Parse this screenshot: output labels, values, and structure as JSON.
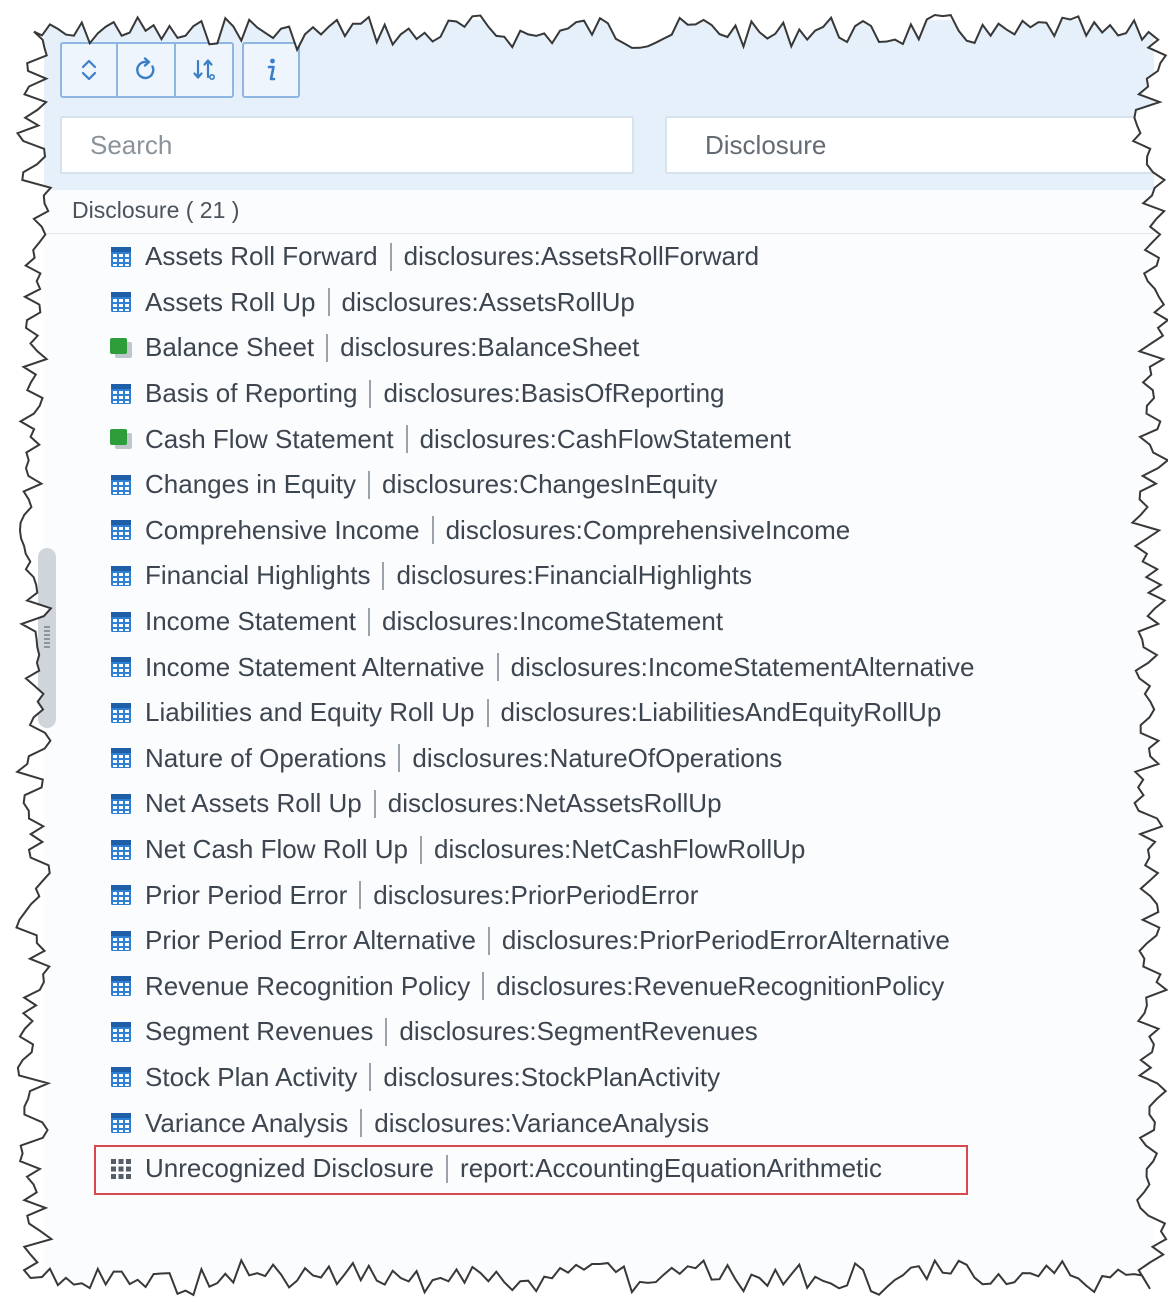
{
  "toolbar": {
    "buttons": [
      {
        "icon": "expand-collapse-icon",
        "label": "⌃⌄"
      },
      {
        "icon": "refresh-icon",
        "label": "↻"
      },
      {
        "icon": "sort-icon",
        "label": "↓↑"
      },
      {
        "icon": "info-icon",
        "label": "i"
      }
    ]
  },
  "search": {
    "placeholder": "Search"
  },
  "filter": {
    "value": "Disclosure"
  },
  "group": {
    "header": "Disclosure ( 21 )"
  },
  "colors": {
    "table_icon": "#2f7fd3",
    "statement_icon": "#2e9e3a",
    "unrecognized_icon": "#555d66",
    "highlight": "#d9474f",
    "accent": "#3a7fc8"
  },
  "items": [
    {
      "name": "Assets Roll Forward",
      "id": "disclosures:AssetsRollForward",
      "icon": "table-icon"
    },
    {
      "name": "Assets Roll Up",
      "id": "disclosures:AssetsRollUp",
      "icon": "table-icon"
    },
    {
      "name": "Balance Sheet",
      "id": "disclosures:BalanceSheet",
      "icon": "statement-icon"
    },
    {
      "name": "Basis of Reporting",
      "id": "disclosures:BasisOfReporting",
      "icon": "table-icon"
    },
    {
      "name": "Cash Flow Statement",
      "id": "disclosures:CashFlowStatement",
      "icon": "statement-icon"
    },
    {
      "name": "Changes in Equity",
      "id": "disclosures:ChangesInEquity",
      "icon": "table-icon"
    },
    {
      "name": "Comprehensive Income",
      "id": "disclosures:ComprehensiveIncome",
      "icon": "table-icon"
    },
    {
      "name": "Financial Highlights",
      "id": "disclosures:FinancialHighlights",
      "icon": "table-icon"
    },
    {
      "name": "Income Statement",
      "id": "disclosures:IncomeStatement",
      "icon": "table-icon"
    },
    {
      "name": "Income Statement Alternative",
      "id": "disclosures:IncomeStatementAlternative",
      "icon": "table-icon"
    },
    {
      "name": "Liabilities and Equity Roll Up",
      "id": "disclosures:LiabilitiesAndEquityRollUp",
      "icon": "table-icon"
    },
    {
      "name": "Nature of Operations",
      "id": "disclosures:NatureOfOperations",
      "icon": "table-icon"
    },
    {
      "name": "Net Assets Roll Up",
      "id": "disclosures:NetAssetsRollUp",
      "icon": "table-icon"
    },
    {
      "name": "Net Cash Flow Roll Up",
      "id": "disclosures:NetCashFlowRollUp",
      "icon": "table-icon"
    },
    {
      "name": "Prior Period Error",
      "id": "disclosures:PriorPeriodError",
      "icon": "table-icon"
    },
    {
      "name": "Prior Period Error Alternative",
      "id": "disclosures:PriorPeriodErrorAlternative",
      "icon": "table-icon"
    },
    {
      "name": "Revenue Recognition Policy",
      "id": "disclosures:RevenueRecognitionPolicy",
      "icon": "table-icon"
    },
    {
      "name": "Segment Revenues",
      "id": "disclosures:SegmentRevenues",
      "icon": "table-icon"
    },
    {
      "name": "Stock Plan Activity",
      "id": "disclosures:StockPlanActivity",
      "icon": "table-icon"
    },
    {
      "name": "Variance Analysis",
      "id": "disclosures:VarianceAnalysis",
      "icon": "table-icon"
    },
    {
      "name": "Unrecognized Disclosure",
      "id": "report:AccountingEquationArithmetic",
      "icon": "unrecognized-icon",
      "highlighted": true
    }
  ]
}
